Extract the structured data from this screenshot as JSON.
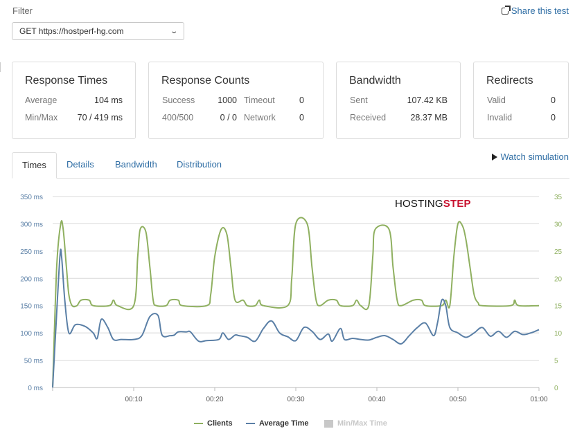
{
  "filter": {
    "label": "Filter",
    "selected": "GET https://hostperf-hg.com"
  },
  "share_label": "Share this test",
  "cards": {
    "response_times": {
      "title": "Response Times",
      "average_label": "Average",
      "average_value": "104 ms",
      "minmax_label": "Min/Max",
      "minmax_value": "70 / 419 ms"
    },
    "response_counts": {
      "title": "Response Counts",
      "success_label": "Success",
      "success_value": "1000",
      "timeout_label": "Timeout",
      "timeout_value": "0",
      "errors_label": "400/500",
      "errors_value": "0 / 0",
      "network_label": "Network",
      "network_value": "0"
    },
    "bandwidth": {
      "title": "Bandwidth",
      "sent_label": "Sent",
      "sent_value": "107.42 KB",
      "received_label": "Received",
      "received_value": "28.37 MB"
    },
    "redirects": {
      "title": "Redirects",
      "valid_label": "Valid",
      "valid_value": "0",
      "invalid_label": "Invalid",
      "invalid_value": "0"
    }
  },
  "tabs": [
    {
      "label": "Times",
      "active": true
    },
    {
      "label": "Details",
      "active": false
    },
    {
      "label": "Bandwidth",
      "active": false
    },
    {
      "label": "Distribution",
      "active": false
    }
  ],
  "watch_label": "Watch simulation",
  "logo": {
    "part1": "HOSTING",
    "part2": "STEP"
  },
  "colors": {
    "clients": "#8fb060",
    "average_time": "#5a7fa6",
    "minmax": "#c8c8c8",
    "link": "#2e6da4"
  },
  "chart_data": {
    "type": "line",
    "x_ticks": [
      "00:10",
      "00:20",
      "00:30",
      "00:40",
      "00:50",
      "01:00"
    ],
    "x_range_seconds": [
      0,
      60
    ],
    "y_left": {
      "ticks": [
        "0 ms",
        "50 ms",
        "100 ms",
        "150 ms",
        "200 ms",
        "250 ms",
        "300 ms",
        "350 ms"
      ],
      "range": [
        0,
        350
      ]
    },
    "y_right": {
      "ticks": [
        "0",
        "5",
        "10",
        "15",
        "20",
        "25",
        "30",
        "35"
      ],
      "range": [
        0,
        35
      ]
    },
    "grid": true,
    "legend_position": "bottom",
    "series": [
      {
        "name": "Clients",
        "axis": "right",
        "points": [
          [
            0,
            0
          ],
          [
            0.5,
            22
          ],
          [
            1,
            30
          ],
          [
            1.3,
            29
          ],
          [
            1.7,
            22
          ],
          [
            2,
            17
          ],
          [
            2.4,
            15
          ],
          [
            3,
            15
          ],
          [
            3.5,
            16
          ],
          [
            4.5,
            16
          ],
          [
            5,
            15
          ],
          [
            7,
            15
          ],
          [
            7.5,
            16
          ],
          [
            8,
            15
          ],
          [
            10,
            15
          ],
          [
            10.5,
            24
          ],
          [
            10.8,
            29
          ],
          [
            11.5,
            28.5
          ],
          [
            12,
            22
          ],
          [
            12.4,
            16
          ],
          [
            12.8,
            15
          ],
          [
            14,
            15
          ],
          [
            14.5,
            16
          ],
          [
            15.5,
            16
          ],
          [
            16,
            15
          ],
          [
            19,
            15
          ],
          [
            19.5,
            17
          ],
          [
            20,
            24
          ],
          [
            20.8,
            29
          ],
          [
            21.5,
            28
          ],
          [
            22,
            22
          ],
          [
            22.5,
            16
          ],
          [
            23.5,
            16
          ],
          [
            24,
            15
          ],
          [
            25,
            15
          ],
          [
            25.5,
            16
          ],
          [
            26,
            15
          ],
          [
            29,
            15
          ],
          [
            29.5,
            20
          ],
          [
            30,
            30
          ],
          [
            31.4,
            30
          ],
          [
            32,
            22
          ],
          [
            32.5,
            16
          ],
          [
            33,
            15
          ],
          [
            34,
            16
          ],
          [
            35,
            16
          ],
          [
            35.5,
            15
          ],
          [
            37,
            15
          ],
          [
            37.5,
            16
          ],
          [
            38,
            15
          ],
          [
            39,
            15
          ],
          [
            39.5,
            24
          ],
          [
            39.8,
            29
          ],
          [
            41.5,
            29
          ],
          [
            42,
            22
          ],
          [
            42.5,
            16
          ],
          [
            43,
            15
          ],
          [
            44.5,
            16
          ],
          [
            45.5,
            16
          ],
          [
            46,
            15
          ],
          [
            48,
            15
          ],
          [
            48.5,
            16
          ],
          [
            49,
            15
          ],
          [
            49.5,
            24
          ],
          [
            50,
            30
          ],
          [
            50.6,
            29.5
          ],
          [
            51,
            27
          ],
          [
            51.5,
            22
          ],
          [
            52,
            17
          ],
          [
            52.5,
            15.5
          ],
          [
            53,
            15
          ],
          [
            56.5,
            15
          ],
          [
            57,
            16
          ],
          [
            57.5,
            15
          ],
          [
            60,
            15
          ]
        ]
      },
      {
        "name": "Average Time",
        "axis": "left",
        "points": [
          [
            0,
            0
          ],
          [
            0.4,
            110
          ],
          [
            0.9,
            240
          ],
          [
            1.1,
            240
          ],
          [
            1.5,
            160
          ],
          [
            2,
            100
          ],
          [
            2.8,
            115
          ],
          [
            4,
            112
          ],
          [
            5,
            100
          ],
          [
            5.5,
            90
          ],
          [
            6,
            125
          ],
          [
            6.8,
            110
          ],
          [
            7.5,
            88
          ],
          [
            8.5,
            88
          ],
          [
            10,
            88
          ],
          [
            11,
            95
          ],
          [
            12,
            130
          ],
          [
            13,
            132
          ],
          [
            13.5,
            96
          ],
          [
            14.5,
            95
          ],
          [
            15,
            96
          ],
          [
            15.5,
            102
          ],
          [
            16.5,
            102
          ],
          [
            17,
            102
          ],
          [
            18,
            85
          ],
          [
            19,
            86
          ],
          [
            20.5,
            88
          ],
          [
            21,
            100
          ],
          [
            21.7,
            88
          ],
          [
            22.5,
            96
          ],
          [
            23,
            95
          ],
          [
            24,
            92
          ],
          [
            25,
            85
          ],
          [
            26,
            108
          ],
          [
            27,
            122
          ],
          [
            28,
            100
          ],
          [
            29,
            93
          ],
          [
            30,
            86
          ],
          [
            31,
            110
          ],
          [
            32,
            103
          ],
          [
            33,
            88
          ],
          [
            34,
            98
          ],
          [
            34.5,
            85
          ],
          [
            35.5,
            108
          ],
          [
            36,
            88
          ],
          [
            37,
            90
          ],
          [
            38,
            88
          ],
          [
            39,
            87
          ],
          [
            40,
            92
          ],
          [
            41,
            95
          ],
          [
            42,
            88
          ],
          [
            43,
            80
          ],
          [
            44,
            95
          ],
          [
            45,
            110
          ],
          [
            46,
            118
          ],
          [
            47,
            95
          ],
          [
            47.5,
            120
          ],
          [
            48,
            160
          ],
          [
            48.5,
            150
          ],
          [
            49,
            110
          ],
          [
            50,
            100
          ],
          [
            51,
            92
          ],
          [
            52,
            100
          ],
          [
            53,
            110
          ],
          [
            54,
            94
          ],
          [
            55,
            103
          ],
          [
            56,
            92
          ],
          [
            57,
            103
          ],
          [
            58,
            97
          ],
          [
            59,
            100
          ],
          [
            60,
            106
          ]
        ]
      }
    ]
  }
}
